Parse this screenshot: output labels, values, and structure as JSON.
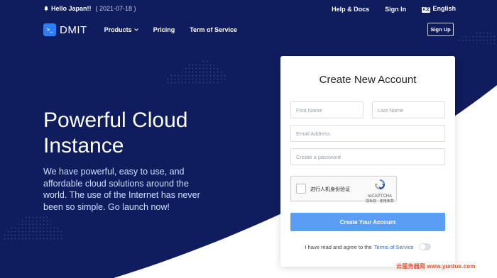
{
  "topbar": {
    "greeting": "Hello Japan!!",
    "date": "( 2021-07-18 )",
    "help": "Help & Docs",
    "signin": "Sign In",
    "lang_icon": "A文",
    "language": "English"
  },
  "nav": {
    "logo_icon": ">_",
    "brand": "DMIT",
    "products": "Products",
    "pricing": "Pricing",
    "terms": "Term of Service",
    "signup": "Sign Up"
  },
  "hero": {
    "title_line1": "Powerful Cloud",
    "title_line2": "Instance",
    "description": "We have powerful, easy to use, and affordable cloud solutions around the world. The use of the Internet has never been so simple. Go launch now!"
  },
  "form": {
    "title": "Create New Account",
    "first_name_placeholder": "First Name",
    "last_name_placeholder": "Last Name",
    "email_placeholder": "Email Address",
    "password_placeholder": "Create a password",
    "captcha_label": "进行人机身份验证",
    "captcha_brand": "reCAPTCHA",
    "captcha_links": "隐私权 - 使用条款",
    "submit": "Create Your Account",
    "agree_text": "I have read and agree to the",
    "agree_link": "Terms of Service"
  },
  "watermark": "云服务器网 www.yuntue.com",
  "colors": {
    "background": "#0f1d5e",
    "accent": "#2d7ff9",
    "button": "#5b9df5",
    "hero_text": "#c9e0ff"
  }
}
